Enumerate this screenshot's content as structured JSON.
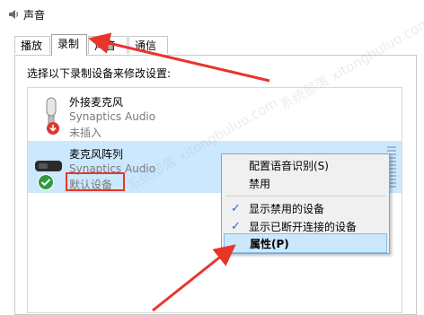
{
  "window": {
    "title": "声音"
  },
  "tabs": [
    {
      "label": "播放"
    },
    {
      "label": "录制"
    },
    {
      "label": "声音"
    },
    {
      "label": "通信"
    }
  ],
  "instructions": "选择以下录制设备来修改设置:",
  "devices": [
    {
      "name": "外接麦克风",
      "driver": "Synaptics Audio",
      "status": "未插入",
      "icon": "microphone-icon"
    },
    {
      "name": "麦克风阵列",
      "driver": "Synaptics Audio",
      "status": "默认设备",
      "icon": "mic-array-icon"
    }
  ],
  "context_menu": {
    "items": [
      {
        "label": "配置语音识别(S)",
        "checked": false
      },
      {
        "label": "禁用",
        "checked": false
      },
      {
        "label": "显示禁用的设备",
        "checked": true
      },
      {
        "label": "显示已断开连接的设备",
        "checked": true
      },
      {
        "label": "属性(P)",
        "checked": false
      }
    ],
    "check_glyph": "✓"
  },
  "colors": {
    "selection": "#cce8ff",
    "annotation": "#e8352b",
    "default_badge": "#2e9b3a",
    "unplugged_badge": "#d63a2f"
  },
  "watermark": "系统部落 xitongbuluo.com"
}
